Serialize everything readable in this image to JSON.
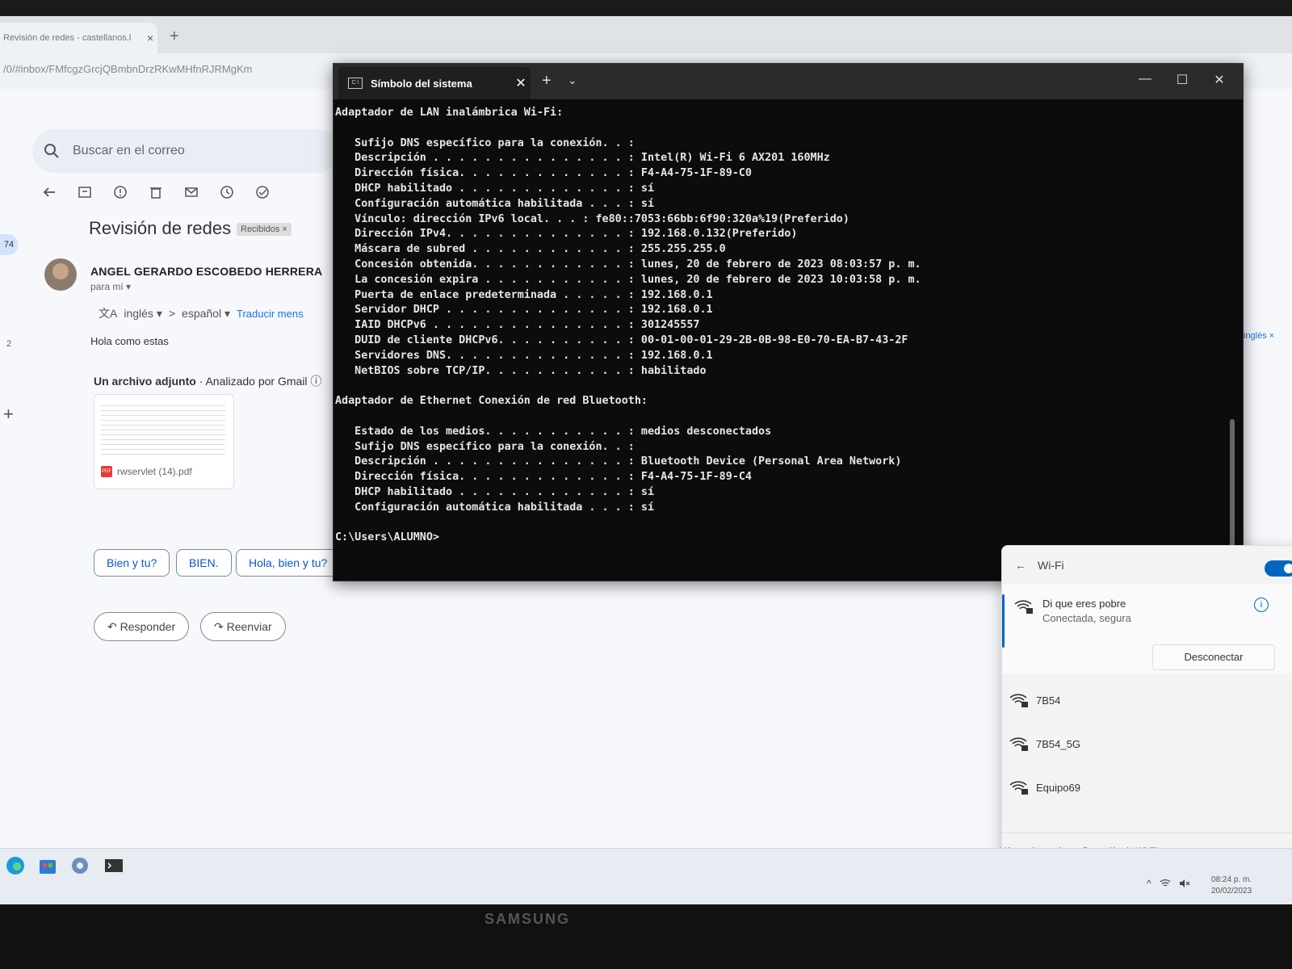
{
  "browser": {
    "tab_title": "Revisión de redes - castellanos.l",
    "tab_close": "×",
    "new_tab": "+",
    "url": "/0/#inbox/FMfcgzGrcjQBmbnDrzRKwMHfnRJRMgKm"
  },
  "gmail": {
    "search_placeholder": "Buscar en el correo",
    "unread_badge": "74",
    "rail_number": "2",
    "rail_plus": "+",
    "subject": "Revisión de redes",
    "label_chip": "Recibidos ×",
    "sender": "ANGEL GERARDO ESCOBEDO HERRERA",
    "to_label": "para mí ▾",
    "translate": {
      "from": "inglés ▾",
      "arrow": ">",
      "to": "español ▾",
      "link": "Traducir mens"
    },
    "body": "Hola como estas",
    "attachment": {
      "title": "Un archivo adjunto",
      "scanned": "Analizado por Gmail",
      "filename": "rwservlet (14).pdf",
      "pdf_badge": "PDF"
    },
    "smart_replies": [
      "Bien y tu?",
      "BIEN.",
      "Hola, bien y tu?"
    ],
    "reply_label": "Responder",
    "forward_label": "Reenviar",
    "right_rail_label": "inglés ×"
  },
  "terminal": {
    "tab_title": "Símbolo del sistema",
    "tab_icon": "C:\\",
    "tab_close": "✕",
    "new_tab": "+",
    "chevron": "⌄",
    "minimize": "—",
    "maximize": "☐",
    "close": "✕",
    "lines": [
      "Adaptador de LAN inalámbrica Wi-Fi:",
      "",
      "   Sufijo DNS específico para la conexión. . :",
      "   Descripción . . . . . . . . . . . . . . . : Intel(R) Wi-Fi 6 AX201 160MHz",
      "   Dirección física. . . . . . . . . . . . . : F4-A4-75-1F-89-C0",
      "   DHCP habilitado . . . . . . . . . . . . . : sí",
      "   Configuración automática habilitada . . . : sí",
      "   Vínculo: dirección IPv6 local. . . : fe80::7053:66bb:6f90:320a%19(Preferido)",
      "   Dirección IPv4. . . . . . . . . . . . . . : 192.168.0.132(Preferido)",
      "   Máscara de subred . . . . . . . . . . . . : 255.255.255.0",
      "   Concesión obtenida. . . . . . . . . . . . : lunes, 20 de febrero de 2023 08:03:57 p. m.",
      "   La concesión expira . . . . . . . . . . . : lunes, 20 de febrero de 2023 10:03:58 p. m.",
      "   Puerta de enlace predeterminada . . . . . : 192.168.0.1",
      "   Servidor DHCP . . . . . . . . . . . . . . : 192.168.0.1",
      "   IAID DHCPv6 . . . . . . . . . . . . . . . : 301245557",
      "   DUID de cliente DHCPv6. . . . . . . . . . : 00-01-00-01-29-2B-0B-98-E0-70-EA-B7-43-2F",
      "   Servidores DNS. . . . . . . . . . . . . . : 192.168.0.1",
      "   NetBIOS sobre TCP/IP. . . . . . . . . . . : habilitado",
      "",
      "Adaptador de Ethernet Conexión de red Bluetooth:",
      "",
      "   Estado de los medios. . . . . . . . . . . : medios desconectados",
      "   Sufijo DNS específico para la conexión. . :",
      "   Descripción . . . . . . . . . . . . . . . : Bluetooth Device (Personal Area Network)",
      "   Dirección física. . . . . . . . . . . . . : F4-A4-75-1F-89-C4",
      "   DHCP habilitado . . . . . . . . . . . . . : sí",
      "   Configuración automática habilitada . . . : sí",
      "",
      "C:\\Users\\ALUMNO>"
    ]
  },
  "wifi": {
    "title": "Wi-Fi",
    "back": "←",
    "enabled": true,
    "connected": {
      "name": "Di que eres pobre",
      "status": "Conectada, segura",
      "info": "i",
      "disconnect_label": "Desconectar"
    },
    "networks": [
      "7B54",
      "7B54_5G",
      "Equipo69"
    ],
    "more_label": "Más opciones de configuración de Wi-Fi"
  },
  "taskbar": {
    "tray_chevron": "^",
    "time": "08:24 p. m.",
    "date": "20/02/2023"
  },
  "monitor_brand": "SAMSUNG",
  "colors": {
    "accent": "#0067c0",
    "gmail_link": "#1a73e8",
    "terminal_bg": "#0c0c0c"
  }
}
